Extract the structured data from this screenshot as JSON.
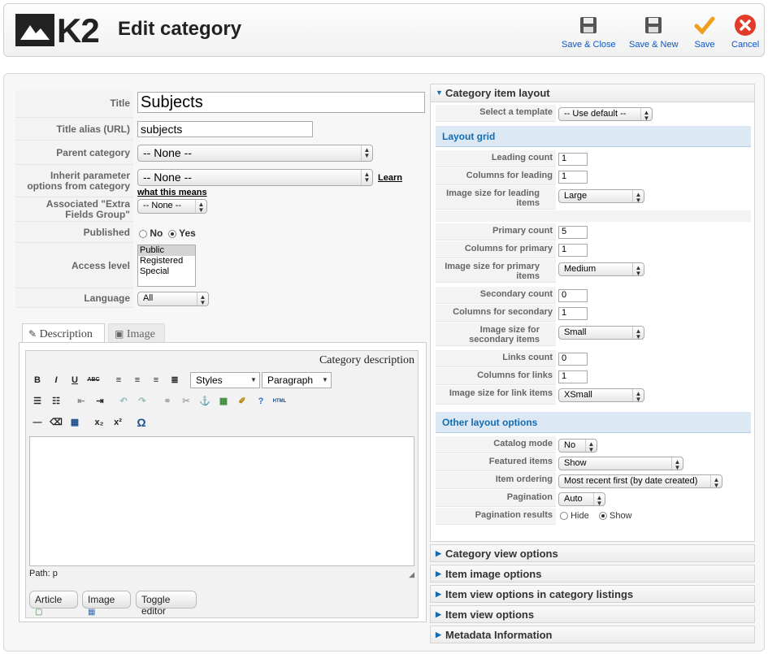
{
  "header": {
    "logo_text": "K2",
    "title": "Edit category",
    "toolbar": {
      "save_close": "Save & Close",
      "save_new": "Save & New",
      "save": "Save",
      "cancel": "Cancel"
    }
  },
  "form": {
    "title_label": "Title",
    "title_value": "Subjects",
    "alias_label": "Title alias (URL)",
    "alias_value": "subjects",
    "parent_label": "Parent category",
    "parent_value": "-- None --",
    "inherit_label": "Inherit parameter options from category",
    "inherit_value": "-- None --",
    "inherit_link_1": "Learn",
    "inherit_link_2": "what this means",
    "extra_fields_label": "Associated \"Extra Fields Group\"",
    "extra_fields_value": "-- None --",
    "published_label": "Published",
    "published_no": "No",
    "published_yes": "Yes",
    "access_label": "Access level",
    "access_options": [
      "Public",
      "Registered",
      "Special"
    ],
    "language_label": "Language",
    "language_value": "All"
  },
  "tabs": {
    "description": "Description",
    "image": "Image"
  },
  "editor": {
    "caption": "Category description",
    "styles": "Styles",
    "format": "Paragraph",
    "path": "Path: p",
    "btn_article": "Article",
    "btn_image": "Image",
    "btn_toggle": "Toggle editor",
    "glyphs": {
      "bold": "B",
      "italic": "I",
      "underline": "U",
      "strike": "ABC",
      "sub": "x₂",
      "sup": "x²",
      "omega": "Ω",
      "html": "HTML"
    }
  },
  "right": {
    "item_layout_title": "Category item layout",
    "template_label": "Select a template",
    "template_value": "-- Use default --",
    "layout_grid_title": "Layout grid",
    "leading_count_label": "Leading count",
    "leading_count_value": "1",
    "columns_leading_label": "Columns for leading",
    "columns_leading_value": "1",
    "image_leading_label": "Image size for leading items",
    "image_leading_value": "Large",
    "primary_count_label": "Primary count",
    "primary_count_value": "5",
    "columns_primary_label": "Columns for primary",
    "columns_primary_value": "1",
    "image_primary_label": "Image size for primary items",
    "image_primary_value": "Medium",
    "secondary_count_label": "Secondary count",
    "secondary_count_value": "0",
    "columns_secondary_label": "Columns for secondary",
    "columns_secondary_value": "1",
    "image_secondary_label": "Image size for secondary items",
    "image_secondary_value": "Small",
    "links_count_label": "Links count",
    "links_count_value": "0",
    "columns_links_label": "Columns for links",
    "columns_links_value": "1",
    "image_links_label": "Image size for link items",
    "image_links_value": "XSmall",
    "other_title": "Other layout options",
    "catalog_label": "Catalog mode",
    "catalog_value": "No",
    "featured_label": "Featured items",
    "featured_value": "Show",
    "ordering_label": "Item ordering",
    "ordering_value": "Most recent first (by date created)",
    "pagination_label": "Pagination",
    "pagination_value": "Auto",
    "pag_results_label": "Pagination results",
    "pag_results_hide": "Hide",
    "pag_results_show": "Show",
    "collapsed": [
      "Category view options",
      "Item image options",
      "Item view options in category listings",
      "Item view options",
      "Metadata Information"
    ]
  }
}
